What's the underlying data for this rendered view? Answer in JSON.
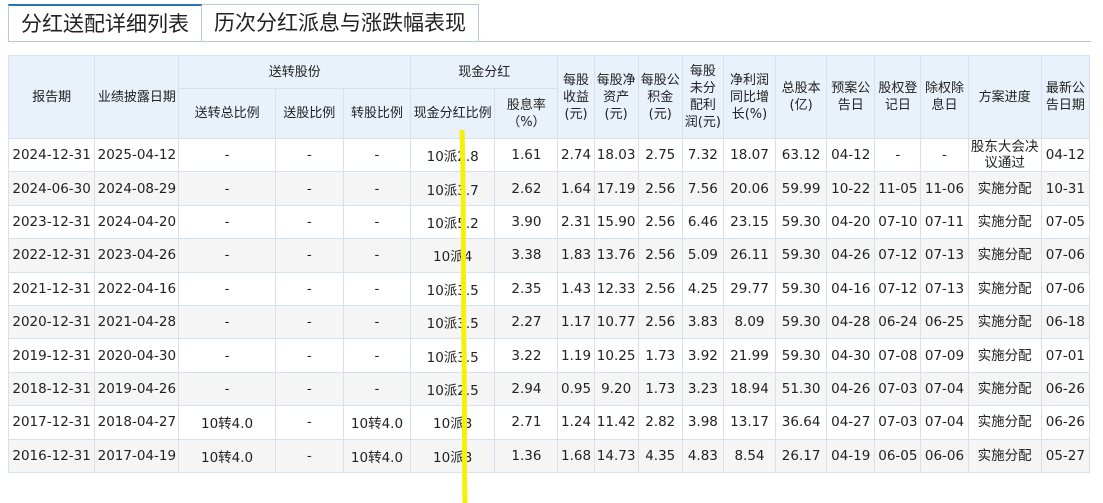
{
  "tabs": [
    {
      "label": "分红送配详细列表",
      "active": true
    },
    {
      "label": "历次分红派息与涨跌幅表现",
      "active": false
    }
  ],
  "table": {
    "headers": {
      "report_period": "报告期",
      "disclosure_date": "业绩披露日期",
      "bonus_group": "送转股份",
      "bonus_total": "送转总比例",
      "bonus_ratio": "送股比例",
      "transfer_ratio": "转股比例",
      "cash_group": "现金分红",
      "cash_ratio": "现金分红比例",
      "yield": "股息率（%）",
      "eps": "每股收益(元)",
      "navps": "每股净资产(元)",
      "reserve": "每股公积金(元)",
      "undistributed": "每股未分配利润(元)",
      "np_growth": "净利润同比增长(%)",
      "total_shares": "总股本(亿)",
      "plan_date": "预案公告日",
      "record_date": "股权登记日",
      "ex_date": "除权除息日",
      "progress": "方案进度",
      "latest_date": "最新公告日期"
    },
    "rows": [
      {
        "report_period": "2024-12-31",
        "disclosure_date": "2025-04-12",
        "bonus_total": "-",
        "bonus_ratio": "-",
        "transfer_ratio": "-",
        "cash_ratio": "10派2.8",
        "yield": "1.61",
        "eps": "2.74",
        "navps": "18.03",
        "reserve": "2.75",
        "undistributed": "7.32",
        "np_growth": "18.07",
        "total_shares": "63.12",
        "plan_date": "04-12",
        "record_date": "-",
        "ex_date": "-",
        "progress": "股东大会决议通过",
        "latest_date": "04-12"
      },
      {
        "report_period": "2024-06-30",
        "disclosure_date": "2024-08-29",
        "bonus_total": "-",
        "bonus_ratio": "-",
        "transfer_ratio": "-",
        "cash_ratio": "10派3.7",
        "yield": "2.62",
        "eps": "1.64",
        "navps": "17.19",
        "reserve": "2.56",
        "undistributed": "7.56",
        "np_growth": "20.06",
        "total_shares": "59.99",
        "plan_date": "10-22",
        "record_date": "11-05",
        "ex_date": "11-06",
        "progress": "实施分配",
        "latest_date": "10-31"
      },
      {
        "report_period": "2023-12-31",
        "disclosure_date": "2024-04-20",
        "bonus_total": "-",
        "bonus_ratio": "-",
        "transfer_ratio": "-",
        "cash_ratio": "10派5.2",
        "yield": "3.90",
        "eps": "2.31",
        "navps": "15.90",
        "reserve": "2.56",
        "undistributed": "6.46",
        "np_growth": "23.15",
        "total_shares": "59.30",
        "plan_date": "04-20",
        "record_date": "07-10",
        "ex_date": "07-11",
        "progress": "实施分配",
        "latest_date": "07-05"
      },
      {
        "report_period": "2022-12-31",
        "disclosure_date": "2023-04-26",
        "bonus_total": "-",
        "bonus_ratio": "-",
        "transfer_ratio": "-",
        "cash_ratio": "10派4",
        "yield": "3.38",
        "eps": "1.83",
        "navps": "13.76",
        "reserve": "2.56",
        "undistributed": "5.09",
        "np_growth": "26.11",
        "total_shares": "59.30",
        "plan_date": "04-26",
        "record_date": "07-12",
        "ex_date": "07-13",
        "progress": "实施分配",
        "latest_date": "07-06"
      },
      {
        "report_period": "2021-12-31",
        "disclosure_date": "2022-04-16",
        "bonus_total": "-",
        "bonus_ratio": "-",
        "transfer_ratio": "-",
        "cash_ratio": "10派3.5",
        "yield": "2.35",
        "eps": "1.43",
        "navps": "12.33",
        "reserve": "2.56",
        "undistributed": "4.25",
        "np_growth": "29.77",
        "total_shares": "59.30",
        "plan_date": "04-16",
        "record_date": "07-12",
        "ex_date": "07-13",
        "progress": "实施分配",
        "latest_date": "07-06"
      },
      {
        "report_period": "2020-12-31",
        "disclosure_date": "2021-04-28",
        "bonus_total": "-",
        "bonus_ratio": "-",
        "transfer_ratio": "-",
        "cash_ratio": "10派3.5",
        "yield": "2.27",
        "eps": "1.17",
        "navps": "10.77",
        "reserve": "2.56",
        "undistributed": "3.83",
        "np_growth": "8.09",
        "total_shares": "59.30",
        "plan_date": "04-28",
        "record_date": "06-24",
        "ex_date": "06-25",
        "progress": "实施分配",
        "latest_date": "06-18"
      },
      {
        "report_period": "2019-12-31",
        "disclosure_date": "2020-04-30",
        "bonus_total": "-",
        "bonus_ratio": "-",
        "transfer_ratio": "-",
        "cash_ratio": "10派3.5",
        "yield": "3.22",
        "eps": "1.19",
        "navps": "10.25",
        "reserve": "1.73",
        "undistributed": "3.92",
        "np_growth": "21.99",
        "total_shares": "59.30",
        "plan_date": "04-30",
        "record_date": "07-08",
        "ex_date": "07-09",
        "progress": "实施分配",
        "latest_date": "07-01"
      },
      {
        "report_period": "2018-12-31",
        "disclosure_date": "2019-04-26",
        "bonus_total": "-",
        "bonus_ratio": "-",
        "transfer_ratio": "-",
        "cash_ratio": "10派2.5",
        "yield": "2.94",
        "eps": "0.95",
        "navps": "9.20",
        "reserve": "1.73",
        "undistributed": "3.23",
        "np_growth": "18.94",
        "total_shares": "51.30",
        "plan_date": "04-26",
        "record_date": "07-03",
        "ex_date": "07-04",
        "progress": "实施分配",
        "latest_date": "06-26"
      },
      {
        "report_period": "2017-12-31",
        "disclosure_date": "2018-04-27",
        "bonus_total": "10转4.0",
        "bonus_ratio": "-",
        "transfer_ratio": "10转4.0",
        "cash_ratio": "10派3",
        "yield": "2.71",
        "eps": "1.24",
        "navps": "11.42",
        "reserve": "2.82",
        "undistributed": "3.98",
        "np_growth": "13.17",
        "total_shares": "36.64",
        "plan_date": "04-27",
        "record_date": "07-03",
        "ex_date": "07-04",
        "progress": "实施分配",
        "latest_date": "06-26"
      },
      {
        "report_period": "2016-12-31",
        "disclosure_date": "2017-04-19",
        "bonus_total": "10转4.0",
        "bonus_ratio": "-",
        "transfer_ratio": "10转4.0",
        "cash_ratio": "10派3",
        "yield": "1.36",
        "eps": "1.68",
        "navps": "14.73",
        "reserve": "4.35",
        "undistributed": "4.83",
        "np_growth": "8.54",
        "total_shares": "26.17",
        "plan_date": "04-19",
        "record_date": "06-05",
        "ex_date": "06-06",
        "progress": "实施分配",
        "latest_date": "05-27"
      }
    ]
  },
  "colors": {
    "accent": "#2b6fb7",
    "header_bg": "#e9f1fb",
    "border": "#d6e1ee",
    "stripe": "#f5f5f5",
    "highlight": "#f5f10a"
  }
}
